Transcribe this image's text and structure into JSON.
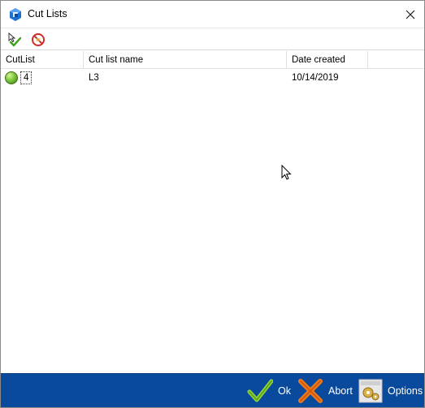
{
  "window": {
    "title": "Cut Lists"
  },
  "toolbar": {
    "buttons": [
      {
        "name": "select-all",
        "icon": "checkmark-cursor-icon"
      },
      {
        "name": "cancel",
        "icon": "no-entry-icon"
      }
    ]
  },
  "grid": {
    "columns": [
      "CutList",
      "Cut list name",
      "Date created"
    ],
    "rows": [
      {
        "status": "green",
        "id": "4",
        "name": "L3",
        "date": "10/14/2019"
      }
    ]
  },
  "footer": {
    "ok_label": "Ok",
    "abort_label": "Abort",
    "options_label": "Options"
  },
  "colors": {
    "footer_bg": "#0a4a9c",
    "status_green": "#6cc22e"
  }
}
